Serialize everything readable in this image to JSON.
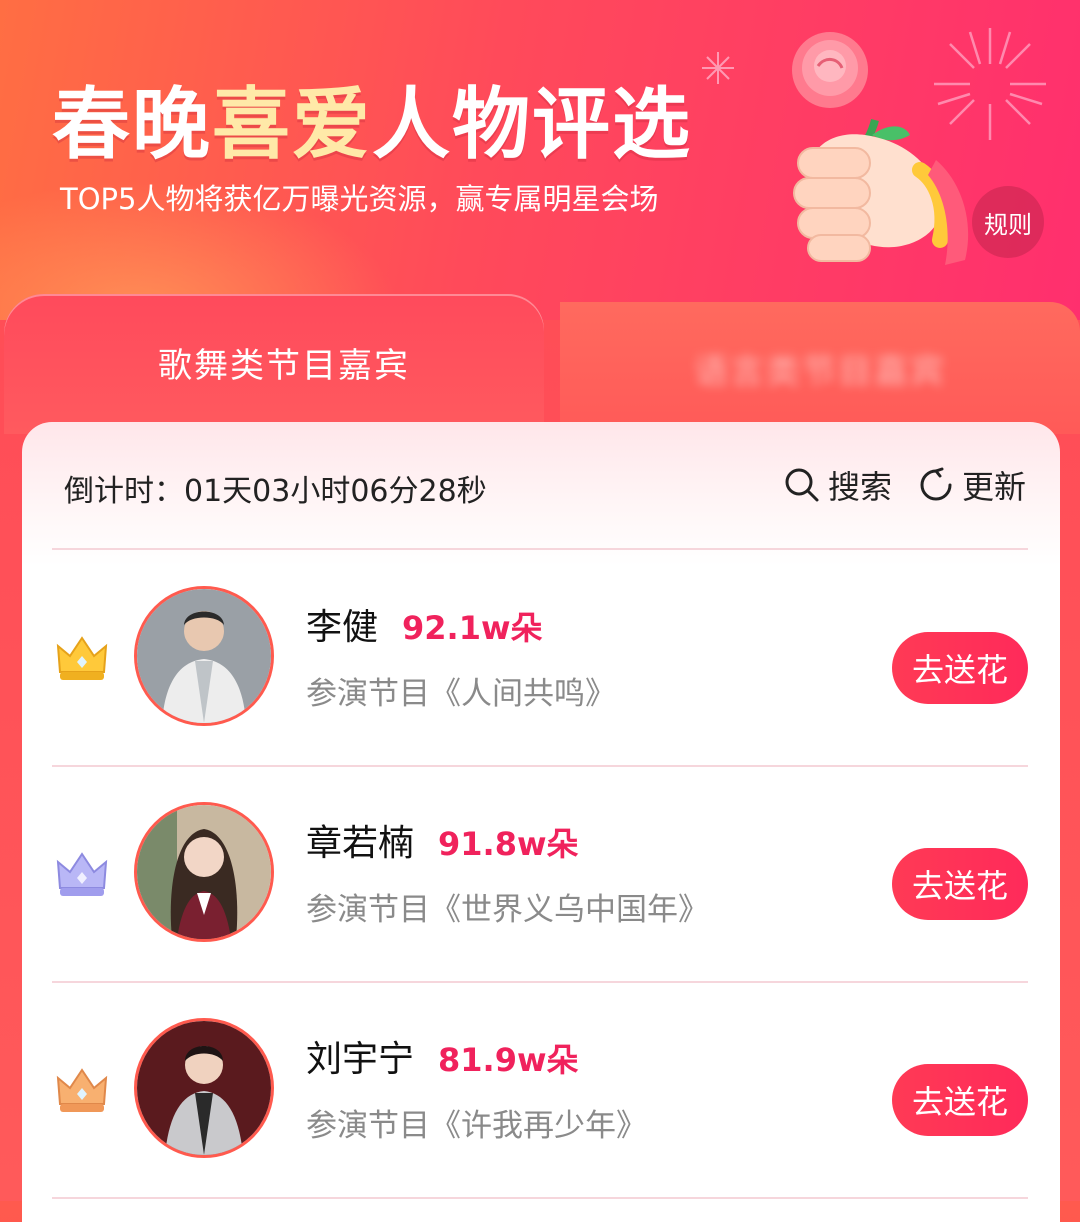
{
  "banner": {
    "title_part1": "春晚",
    "title_highlight": "喜爱",
    "title_part2": "人物评选",
    "subtitle": "TOP5人物将获亿万曝光资源，赢专属明星会场",
    "rules_label": "规则"
  },
  "tabs": {
    "active_label": "歌舞类节目嘉宾",
    "inactive_label": "语言类节目嘉宾"
  },
  "toolbar": {
    "countdown": "倒计时：01天03小时06分28秒",
    "search_label": "搜索",
    "refresh_label": "更新"
  },
  "ranking": [
    {
      "rank": 1,
      "crown": "gold-crown",
      "name": "李健",
      "flowers": "92.1w朵",
      "program": "参演节目《人间共鸣》",
      "button": "去送花"
    },
    {
      "rank": 2,
      "crown": "silver-crown",
      "name": "章若楠",
      "flowers": "91.8w朵",
      "program": "参演节目《世界义乌中国年》",
      "button": "去送花"
    },
    {
      "rank": 3,
      "crown": "bronze-crown",
      "name": "刘宇宁",
      "flowers": "81.9w朵",
      "program": "参演节目《许我再少年》",
      "button": "去送花"
    }
  ],
  "colors": {
    "accent": "#f0225c",
    "button": "#ff3a55",
    "gold": "#ffc93a",
    "silver": "#a8a6f2",
    "bronze": "#f5a060"
  }
}
